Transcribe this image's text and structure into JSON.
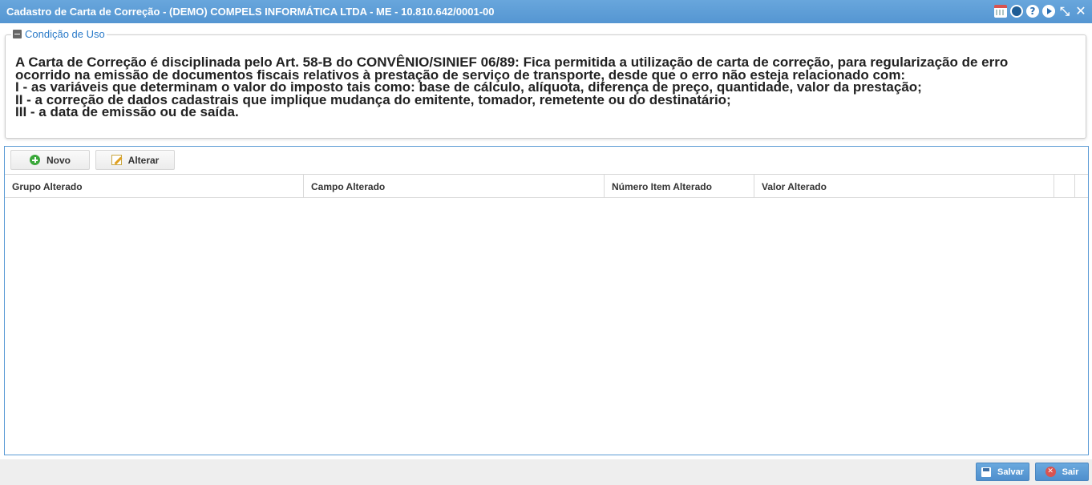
{
  "window": {
    "title": "Cadastro de Carta de Correção - (DEMO) COMPELS INFORMÁTICA LTDA - ME - 10.810.642/0001-00",
    "icons": [
      "calendar-icon",
      "record-icon",
      "help-icon",
      "play-icon",
      "shrink-icon",
      "close-icon"
    ],
    "help_glyph": "?",
    "shrink_glyph": "⤡",
    "close_glyph": "✕"
  },
  "usage": {
    "legend": "Condição de Uso",
    "lines": [
      "A Carta de Correção é disciplinada pelo Art. 58-B do CONVÊNIO/SINIEF 06/89: Fica permitida a utilização de carta de correção, para regularização de erro",
      "ocorrido na emissão de documentos fiscais relativos à prestação de serviço de transporte, desde que o erro não esteja relacionado com:",
      "I - as variáveis que determinam o valor do imposto tais como: base de cálculo, alíquota, diferença de preço, quantidade, valor da prestação;",
      "II - a correção de dados cadastrais que implique mudança do emitente, tomador, remetente ou do destinatário;",
      "III - a data de emissão ou de saída."
    ]
  },
  "toolbar": {
    "new_label": "Novo",
    "edit_label": "Alterar"
  },
  "grid": {
    "columns": [
      "Grupo Alterado",
      "Campo Alterado",
      "Número Item Alterado",
      "Valor Alterado",
      "",
      ""
    ],
    "rows": []
  },
  "footer": {
    "save_label": "Salvar",
    "exit_label": "Sair"
  },
  "colors": {
    "titlebar": "#5b9bd5",
    "legend_text": "#2a7ac8",
    "button_blue": "#5b9bd5"
  }
}
